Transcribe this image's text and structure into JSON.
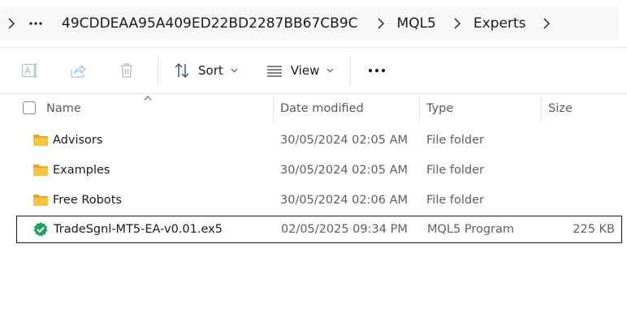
{
  "address_bar": {
    "crumbs": [
      "49CDDEAA95A409ED22BD2287BB67CB9C",
      "MQL5",
      "Experts"
    ]
  },
  "toolbar": {
    "sort_label": "Sort",
    "view_label": "View"
  },
  "columns": {
    "name": "Name",
    "date_modified": "Date modified",
    "type": "Type",
    "size": "Size"
  },
  "files": [
    {
      "name": "Advisors",
      "date": "30/05/2024 02:05 AM",
      "type": "File folder",
      "size": "",
      "icon": "folder-icon"
    },
    {
      "name": "Examples",
      "date": "30/05/2024 02:05 AM",
      "type": "File folder",
      "size": "",
      "icon": "folder-icon"
    },
    {
      "name": "Free Robots",
      "date": "30/05/2024 02:06 AM",
      "type": "File folder",
      "size": "",
      "icon": "folder-icon"
    },
    {
      "name": "TradeSgnl-MT5-EA-v0.01.ex5",
      "date": "02/05/2025 09:34 PM",
      "type": "MQL5 Program",
      "size": "225 KB",
      "icon": "mql5-program-icon"
    }
  ],
  "colors": {
    "folder": "#f5c440",
    "folder_dark": "#e2a82a",
    "mql5_badge": "#1fa35a",
    "selection_border": "#1a1a1a"
  }
}
